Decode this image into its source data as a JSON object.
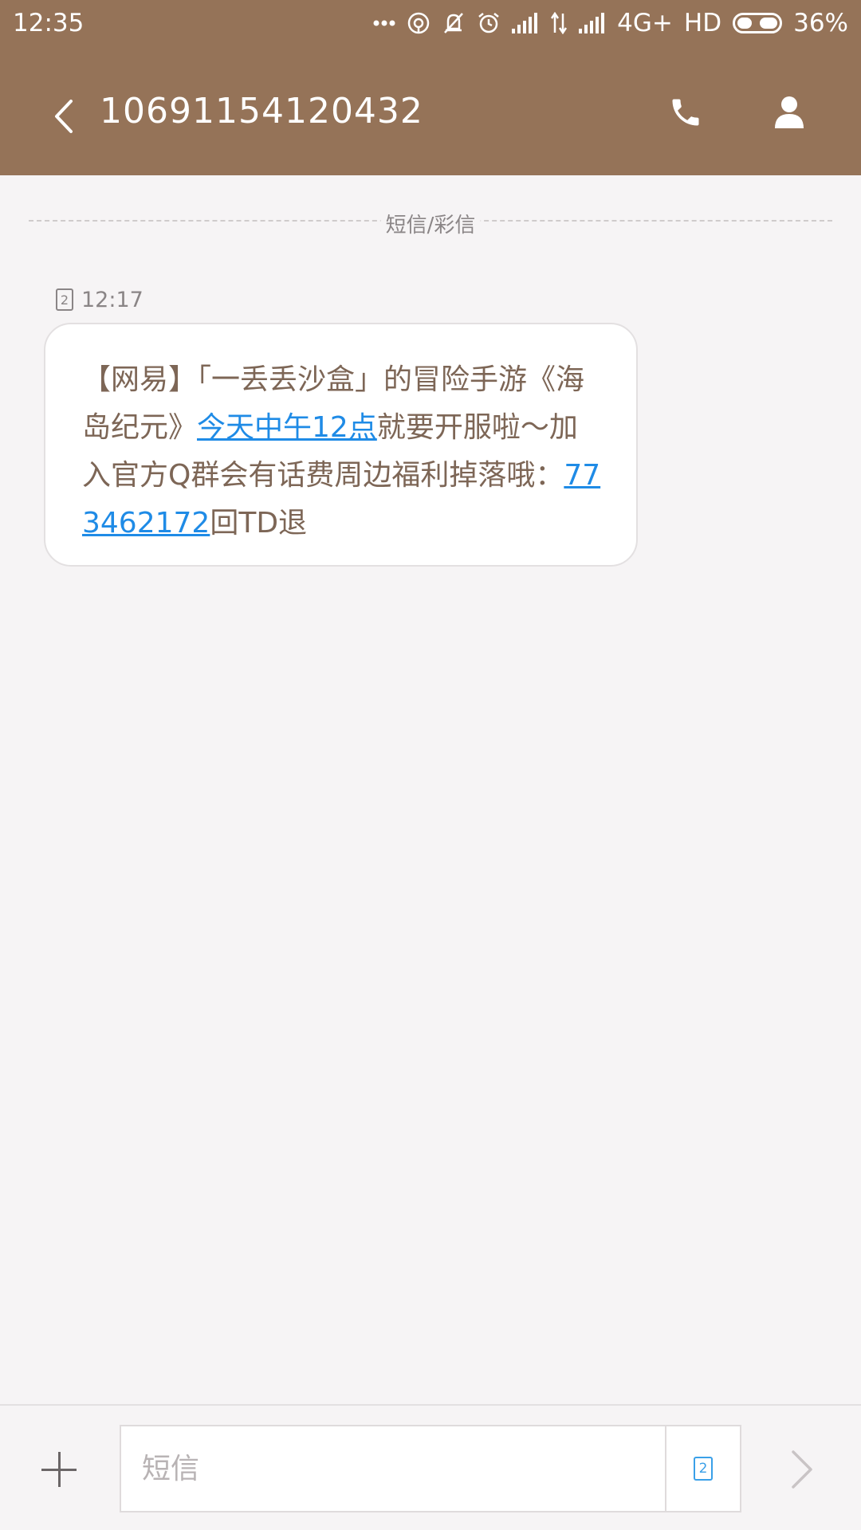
{
  "status_bar": {
    "time": "12:35",
    "network": "4G+",
    "hd": "HD",
    "battery": "36%",
    "icons": [
      "more-dots-icon",
      "hotspot-icon",
      "mute-icon",
      "alarm-icon",
      "signal-icon",
      "data-transfer-icon",
      "signal-icon"
    ]
  },
  "header": {
    "title": "10691154120432",
    "back_icon": "back-arrow-icon",
    "call_icon": "phone-icon",
    "contact_icon": "person-icon",
    "accent_color": "#957358"
  },
  "conversation": {
    "divider_label": "短信/彩信",
    "messages": [
      {
        "sim": "2",
        "time": "12:17",
        "text_parts": {
          "p1": "【网易】「一丢丢沙盒」的冒险手游《海岛纪元》",
          "link1": "今天中午12点",
          "p2": "就要开服啦～加入官方Q群会有话费周边福利掉落哦：",
          "link2": "773462172",
          "p3": "回TD退"
        }
      }
    ]
  },
  "composer": {
    "placeholder": "短信",
    "sim": "2",
    "add_icon": "plus-icon",
    "send_icon": "send-arrow-icon"
  }
}
